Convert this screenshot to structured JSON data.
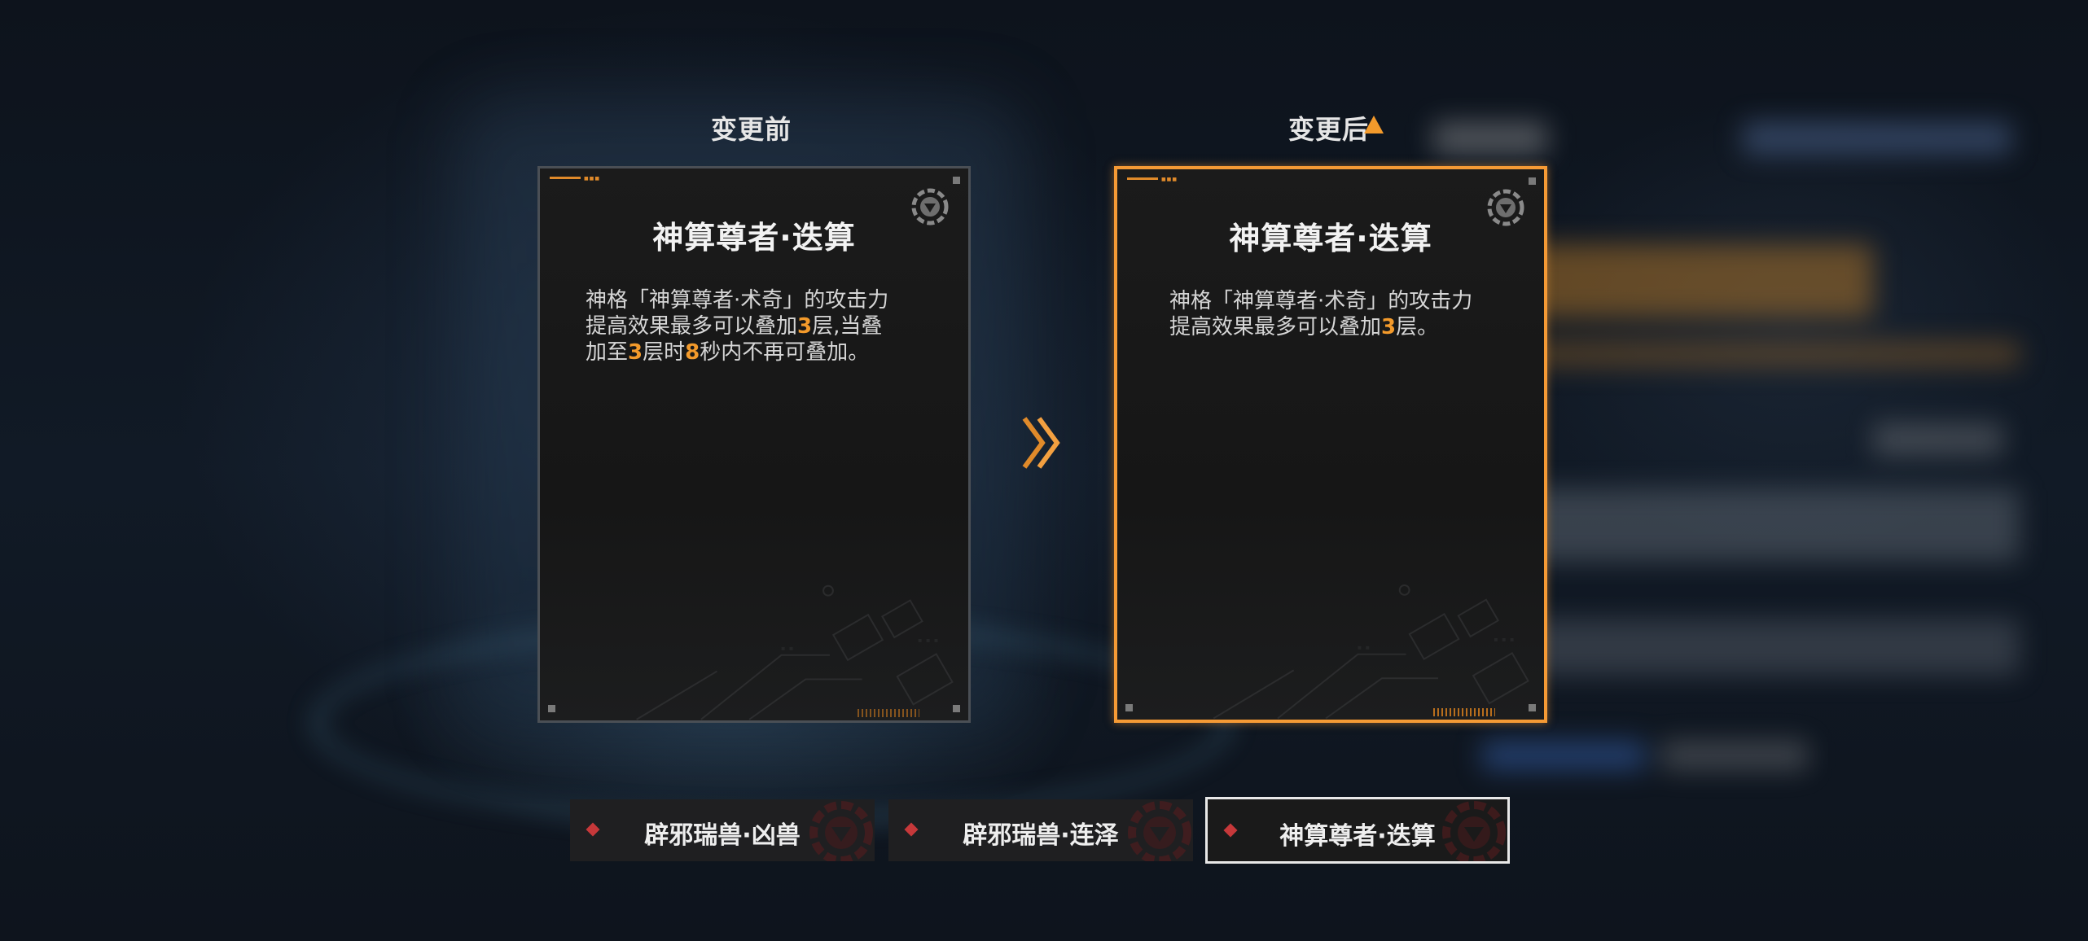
{
  "before_column": {
    "header": "变更前",
    "card": {
      "title": "神算尊者·迭算",
      "description": {
        "line1": "神格「神算尊者·术奇」的攻击力提高效果最多可以叠加",
        "n1": "3",
        "mid1": "层,当叠加至",
        "n2": "3",
        "mid2": "层时",
        "n3": "8",
        "tail": "秒内不再可叠加。"
      }
    }
  },
  "after_column": {
    "header": "变更后",
    "card": {
      "title": "神算尊者·迭算",
      "description": {
        "line1": "神格「神算尊者·术奇」的攻击力提高效果最多可以叠加",
        "n1": "3",
        "tail": "层。"
      }
    }
  },
  "tabs": [
    {
      "label": "辟邪瑞兽·凶兽",
      "selected": false
    },
    {
      "label": "辟邪瑞兽·连泽",
      "selected": false
    },
    {
      "label": "神算尊者·迭算",
      "selected": true
    }
  ],
  "colors": {
    "accent": "#f59a35",
    "highlight_number": "#f39a2b",
    "tab_diamond": "#c6383a",
    "card_border_before": "#4a4f55"
  },
  "icons": {
    "card_emblem": "gear-triangle-emblem-icon",
    "transition_arrow": "double-chevron-right-icon",
    "header_indicator": "up-arrow-icon",
    "tab_marker": "red-diamond-icon"
  }
}
